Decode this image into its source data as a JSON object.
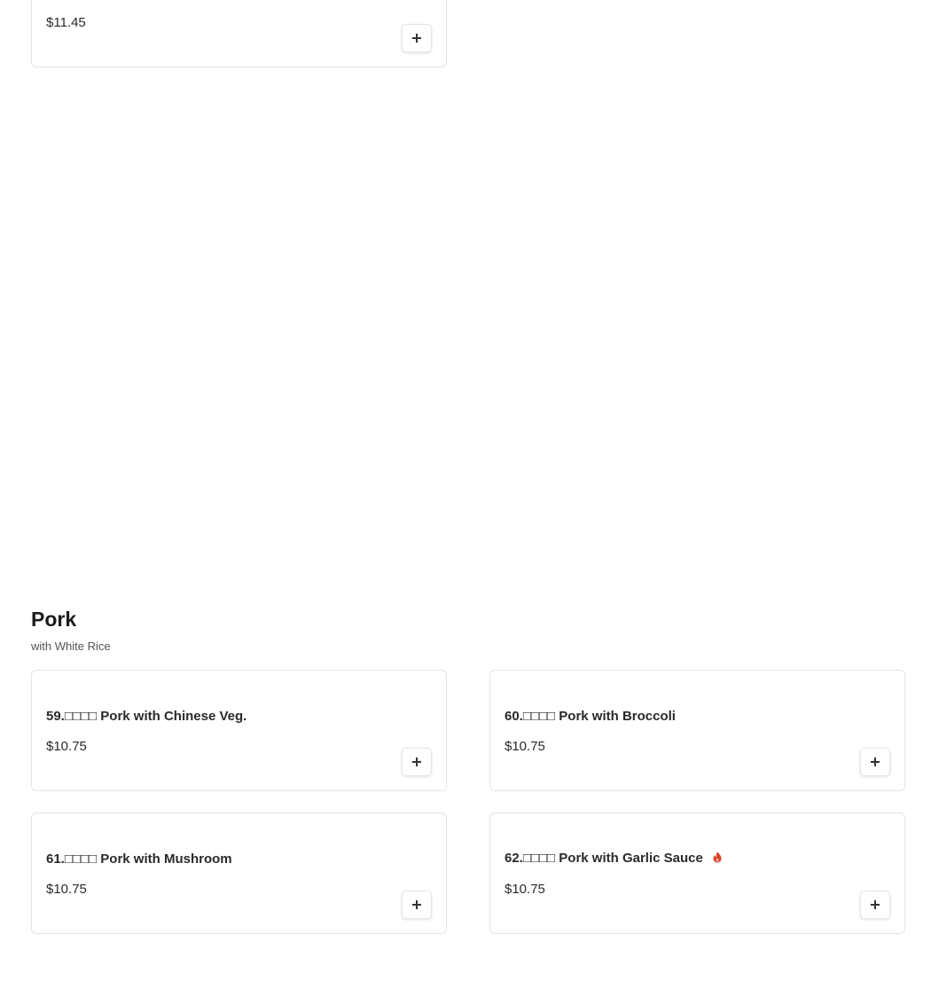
{
  "previous_item": {
    "price": "$11.45"
  },
  "section": {
    "title": "Pork",
    "subtitle": "with White Rice"
  },
  "items": [
    {
      "number": "59.",
      "cjk": "□□□□",
      "name": "Pork with Chinese Veg.",
      "price": "$10.75",
      "spicy": false
    },
    {
      "number": "60.",
      "cjk": "□□□□",
      "name": "Pork with Broccoli",
      "price": "$10.75",
      "spicy": false
    },
    {
      "number": "61.",
      "cjk": "□□□□",
      "name": "Pork with Mushroom",
      "price": "$10.75",
      "spicy": false
    },
    {
      "number": "62.",
      "cjk": "□□□□",
      "name": "Pork with Garlic Sauce",
      "price": "$10.75",
      "spicy": true
    }
  ],
  "icons": {
    "add": "plus-icon",
    "spicy": "chili-pepper-icon"
  },
  "colors": {
    "spicy": "#d9442b",
    "card_border": "#e4e4e4"
  }
}
